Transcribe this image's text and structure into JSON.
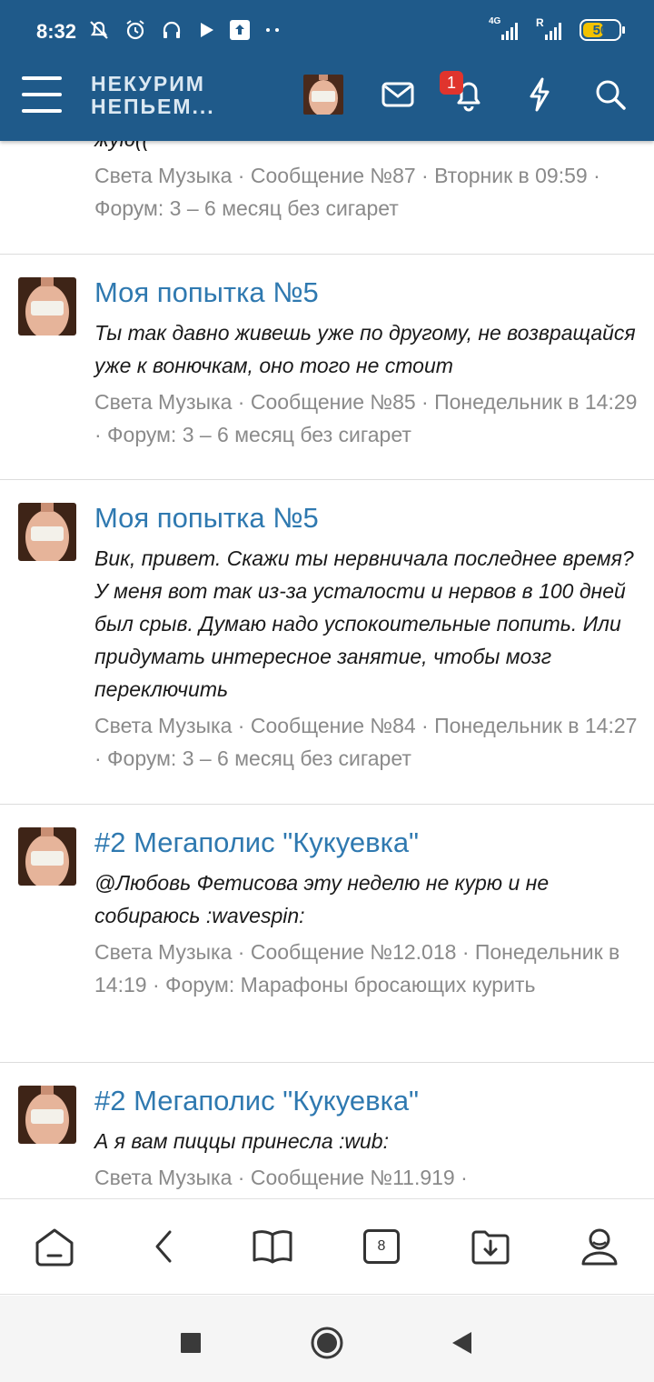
{
  "status_bar": {
    "time": "8:32",
    "icons": [
      "no-notify-icon",
      "alarm-icon",
      "headphones-icon",
      "play-icon",
      "upload-icon",
      "more-dots-icon"
    ],
    "network_4g": "4G",
    "network_r": "R",
    "battery": "50"
  },
  "header": {
    "logo_line1": "НЕКУРИМ",
    "logo_line2": "НЕПЬЕМ...",
    "notification_count": "1",
    "colors": {
      "bar": "#1f5a8a",
      "badge": "#e0342d"
    }
  },
  "feed": {
    "posts": [
      {
        "title": "",
        "text": "жую((",
        "meta": "Света Музыка · Сообщение №87 · Вторник в 09:59 · Форум: 3 – 6 месяц без сигарет"
      },
      {
        "title": "Моя попытка №5",
        "text": "Ты так давно живешь уже по другому, не возвращайся уже к вонючкам, оно того не стоит",
        "meta": "Света Музыка · Сообщение №85 · Понедельник в 14:29 · Форум: 3 – 6 месяц без сигарет"
      },
      {
        "title": "Моя попытка №5",
        "text": "Вик, привет. Скажи ты нервничала последнее время? У меня вот так из-за усталости и нервов в 100 дней был срыв. Думаю надо успокоительные попить. Или придумать интересное занятие, чтобы мозг переключить",
        "meta": "Света Музыка · Сообщение №84 · Понедельник в 14:27 · Форум: 3 – 6 месяц без сигарет"
      },
      {
        "title": "#2 Мегаполис \"Кукуевка\"",
        "text": "@Любовь Фетисова эту неделю не курю и не собираюсь :wavespin:",
        "meta": "Света Музыка · Сообщение №12.018 · Понедельник в 14:19 · Форум: Марафоны бросающих курить"
      },
      {
        "title": "#2 Мегаполис \"Кукуевка\"",
        "text": "А я вам пиццы принесла :wub:",
        "meta": "Света Музыка · Сообщение №11.919 ·"
      }
    ],
    "colors": {
      "title": "#2f79b0",
      "meta": "#8a8a8a"
    }
  },
  "bottom_nav": {
    "items": [
      "home-icon",
      "back-icon",
      "book-icon",
      "tabs-icon",
      "download-icon",
      "profile-icon"
    ],
    "tabs_count": "8"
  },
  "system_nav": {
    "items": [
      "recent-apps-icon",
      "home-circle-icon",
      "back-triangle-icon"
    ]
  }
}
